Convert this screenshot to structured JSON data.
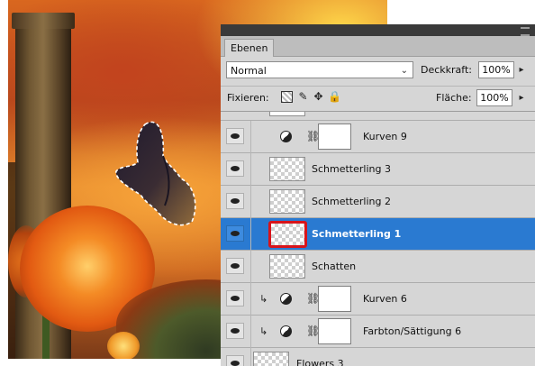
{
  "panel": {
    "tab_label": "Ebenen",
    "blend_mode": "Normal",
    "opacity_label": "Deckkraft:",
    "opacity_value": "100%",
    "lock_label": "Fixieren:",
    "fill_label": "Fläche:",
    "fill_value": "100%",
    "icons": [
      "eye-icon",
      "adjustment-icon",
      "link-icon",
      "clip-arrow-icon",
      "lock-transparency-icon",
      "lock-paint-icon",
      "lock-move-icon",
      "lock-all-icon"
    ]
  },
  "layers": [
    {
      "name": "Kurven 9",
      "type": "adjustment",
      "clipped": false,
      "selected": false
    },
    {
      "name": "Schmetterling 3",
      "type": "pixel",
      "clipped": false,
      "selected": false
    },
    {
      "name": "Schmetterling 2",
      "type": "pixel",
      "clipped": false,
      "selected": false
    },
    {
      "name": "Schmetterling 1",
      "type": "pixel",
      "clipped": false,
      "selected": true
    },
    {
      "name": "Schatten",
      "type": "pixel",
      "clipped": false,
      "selected": false
    },
    {
      "name": "Kurven 6",
      "type": "adjustment",
      "clipped": true,
      "selected": false
    },
    {
      "name": "Farbton/Sättigung 6",
      "type": "adjustment",
      "clipped": true,
      "selected": false
    },
    {
      "name": "Flowers 3",
      "type": "pixel",
      "clipped": false,
      "selected": false
    }
  ],
  "colors": {
    "selection": "#2a7ad1",
    "selected_thumb_border": "#d8141a",
    "panel_bg": "#d6d6d6"
  }
}
